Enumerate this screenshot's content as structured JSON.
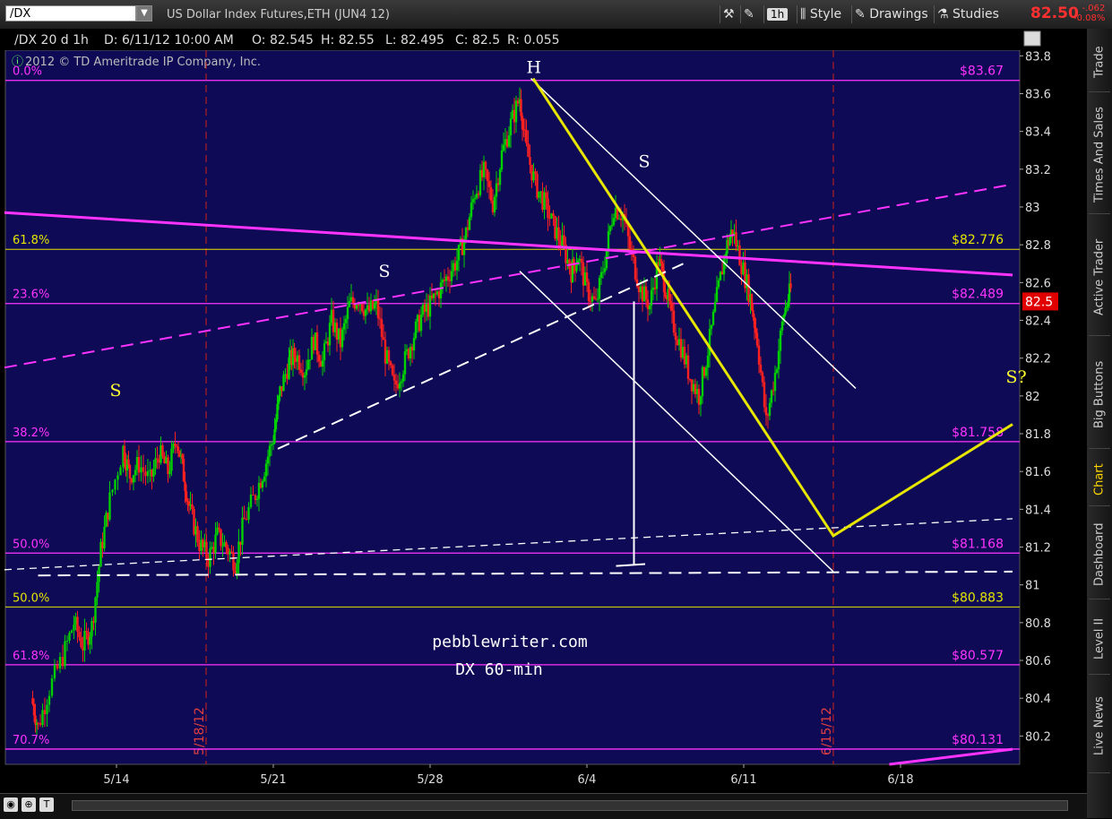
{
  "toolbar": {
    "symbol": "/DX",
    "description": "US Dollar Index Futures,ETH (JUN4 12)",
    "timeframe_btn": "1h",
    "style_btn": "Style",
    "drawings_btn": "Drawings",
    "studies_btn": "Studies",
    "last_price": "82.50",
    "net_change": "-.062",
    "pct_change": "-0.08%"
  },
  "header": {
    "symbol_period": "/DX 20 d 1h",
    "date": "D: 6/11/12 10:00 AM",
    "open": "O: 82.545",
    "high": "H: 82.55",
    "low": "L: 82.495",
    "close": "C: 82.5",
    "range": "R: 0.055",
    "copyright": "2012 © TD Ameritrade IP Company, Inc."
  },
  "side_tabs": [
    {
      "label": "Trade",
      "active": false
    },
    {
      "label": "Times And Sales",
      "active": false
    },
    {
      "label": "Active Trader",
      "active": false
    },
    {
      "label": "Big Buttons",
      "active": false
    },
    {
      "label": "Chart",
      "active": true
    },
    {
      "label": "Dashboard",
      "active": false
    },
    {
      "label": "Level II",
      "active": false
    },
    {
      "label": "Live News",
      "active": false
    }
  ],
  "bottom_bar": {
    "buttons": [
      "◉",
      "⊕",
      "T"
    ]
  },
  "colors": {
    "background": "#0e0a55",
    "up_candle": "#00d000",
    "down_candle": "#ff2020",
    "fib_magenta": "#ff33ff",
    "fib_yellow": "#e6e600",
    "annotation_yellow": "#ffff33",
    "white_lines": "#ffffff",
    "event_line": "#b02020"
  },
  "chart_data": {
    "type": "candlestick",
    "ylim": [
      80.05,
      83.83
    ],
    "y_ticks": [
      "80.2",
      "80.4",
      "80.6",
      "80.8",
      "81",
      "81.2",
      "81.4",
      "81.6",
      "81.8",
      "82",
      "82.2",
      "82.4",
      "82.6",
      "82.8",
      "83",
      "83.2",
      "83.4",
      "83.6",
      "83.8"
    ],
    "x_ticks": [
      "5/14",
      "5/21",
      "5/28",
      "6/4",
      "6/11",
      "6/18"
    ],
    "current_price_label": "82.5",
    "fib_levels": [
      {
        "pct": "0.0%",
        "price": "$83.67",
        "value": 83.67,
        "color": "magenta"
      },
      {
        "pct": "61.8%",
        "price": "$82.776",
        "value": 82.776,
        "color": "yellow"
      },
      {
        "pct": "23.6%",
        "price": "$82.489",
        "value": 82.489,
        "color": "magenta"
      },
      {
        "pct": "38.2%",
        "price": "$81.758",
        "value": 81.758,
        "color": "magenta"
      },
      {
        "pct": "50.0%",
        "price": "$81.168",
        "value": 81.168,
        "color": "magenta"
      },
      {
        "pct": "50.0%",
        "price": "$80.883",
        "value": 80.883,
        "color": "yellow"
      },
      {
        "pct": "61.8%",
        "price": "$80.577",
        "value": 80.577,
        "color": "magenta"
      },
      {
        "pct": "70.7%",
        "price": "$80.131",
        "value": 80.131,
        "color": "magenta"
      }
    ],
    "event_lines": [
      {
        "date": "5/18/12",
        "day": 4
      },
      {
        "date": "6/15/12",
        "day": 32
      }
    ],
    "pattern_labels": [
      {
        "text": "S",
        "day": -0.3,
        "value": 82.0
      },
      {
        "text": "S",
        "day": 11.7,
        "value": 82.63
      },
      {
        "text": "H",
        "day": 18.3,
        "value": 83.71
      },
      {
        "text": "S",
        "day": 23.3,
        "value": 83.21
      },
      {
        "text": "S?",
        "day": 39.7,
        "value": 82.07
      }
    ],
    "annotations": [
      "pebblewriter.com",
      "DX 60-min"
    ],
    "price_anchors": [
      [
        -3.8,
        80.4
      ],
      [
        -3.5,
        80.25
      ],
      [
        -3.0,
        80.45
      ],
      [
        -2.4,
        80.62
      ],
      [
        -1.9,
        80.8
      ],
      [
        -1.5,
        80.68
      ],
      [
        -1.1,
        80.78
      ],
      [
        -0.7,
        81.18
      ],
      [
        -0.3,
        81.45
      ],
      [
        0.3,
        81.72
      ],
      [
        0.6,
        81.58
      ],
      [
        1.0,
        81.64
      ],
      [
        1.5,
        81.55
      ],
      [
        1.9,
        81.7
      ],
      [
        2.3,
        81.6
      ],
      [
        2.7,
        81.78
      ],
      [
        3.0,
        81.58
      ],
      [
        3.3,
        81.38
      ],
      [
        3.7,
        81.22
      ],
      [
        4.1,
        81.14
      ],
      [
        4.5,
        81.26
      ],
      [
        4.9,
        81.2
      ],
      [
        5.3,
        81.12
      ],
      [
        5.7,
        81.34
      ],
      [
        6.2,
        81.48
      ],
      [
        6.6,
        81.62
      ],
      [
        7.0,
        81.78
      ],
      [
        7.3,
        82.02
      ],
      [
        7.7,
        82.18
      ],
      [
        8.0,
        82.22
      ],
      [
        8.4,
        82.14
      ],
      [
        8.8,
        82.3
      ],
      [
        9.2,
        82.18
      ],
      [
        9.6,
        82.4
      ],
      [
        10.0,
        82.28
      ],
      [
        10.4,
        82.48
      ],
      [
        10.8,
        82.52
      ],
      [
        11.2,
        82.44
      ],
      [
        11.6,
        82.48
      ],
      [
        12.0,
        82.22
      ],
      [
        12.4,
        82.04
      ],
      [
        12.8,
        82.16
      ],
      [
        13.2,
        82.3
      ],
      [
        13.6,
        82.42
      ],
      [
        14.0,
        82.48
      ],
      [
        14.4,
        82.56
      ],
      [
        14.8,
        82.64
      ],
      [
        15.2,
        82.72
      ],
      [
        15.6,
        82.86
      ],
      [
        16.0,
        83.08
      ],
      [
        16.4,
        83.18
      ],
      [
        16.8,
        83.02
      ],
      [
        17.2,
        83.28
      ],
      [
        17.6,
        83.44
      ],
      [
        18.0,
        83.58
      ],
      [
        18.3,
        83.3
      ],
      [
        18.7,
        83.12
      ],
      [
        19.1,
        83.02
      ],
      [
        19.5,
        82.9
      ],
      [
        19.9,
        82.8
      ],
      [
        20.3,
        82.66
      ],
      [
        20.6,
        82.74
      ],
      [
        21.0,
        82.56
      ],
      [
        21.4,
        82.48
      ],
      [
        21.8,
        82.72
      ],
      [
        22.2,
        83.0
      ],
      [
        22.6,
        82.96
      ],
      [
        23.0,
        82.74
      ],
      [
        23.4,
        82.56
      ],
      [
        23.8,
        82.48
      ],
      [
        24.2,
        82.72
      ],
      [
        24.5,
        82.58
      ],
      [
        24.8,
        82.4
      ],
      [
        25.2,
        82.26
      ],
      [
        25.6,
        82.1
      ],
      [
        26.0,
        82.0
      ],
      [
        26.4,
        82.24
      ],
      [
        26.8,
        82.52
      ],
      [
        27.2,
        82.78
      ],
      [
        27.5,
        82.88
      ],
      [
        27.9,
        82.7
      ],
      [
        28.3,
        82.52
      ],
      [
        28.6,
        82.3
      ],
      [
        29.0,
        81.86
      ],
      [
        29.4,
        82.12
      ],
      [
        29.8,
        82.44
      ],
      [
        30.1,
        82.56
      ]
    ],
    "lines": [
      {
        "style": "solid",
        "color": "magenta",
        "width": 3,
        "pts": [
          [
            -5,
            82.97
          ],
          [
            40,
            82.64
          ]
        ]
      },
      {
        "style": "dash",
        "color": "magenta",
        "width": 2,
        "pts": [
          [
            -5,
            82.15
          ],
          [
            40,
            83.12
          ]
        ]
      },
      {
        "style": "dash",
        "color": "white",
        "width": 2,
        "pts": [
          [
            7.2,
            81.72
          ],
          [
            25.3,
            82.7
          ]
        ]
      },
      {
        "style": "solid",
        "color": "white",
        "width": 1.5,
        "pts": [
          [
            18.5,
            83.68
          ],
          [
            33,
            82.04
          ]
        ]
      },
      {
        "style": "solid",
        "color": "white",
        "width": 1.5,
        "pts": [
          [
            18.0,
            82.66
          ],
          [
            32,
            81.07
          ]
        ]
      },
      {
        "style": "solid",
        "color": "white",
        "width": 2,
        "pts": [
          [
            23.1,
            82.5
          ],
          [
            23.1,
            81.11
          ]
        ]
      },
      {
        "style": "solid",
        "color": "white",
        "width": 2,
        "pts": [
          [
            22.3,
            81.1
          ],
          [
            23.6,
            81.11
          ]
        ]
      },
      {
        "style": "dash",
        "color": "white",
        "width": 1.3,
        "pts": [
          [
            -5,
            81.08
          ],
          [
            40,
            81.35
          ]
        ]
      },
      {
        "style": "dash",
        "color": "white",
        "width": 2,
        "pts": [
          [
            -3.5,
            81.05
          ],
          [
            40,
            81.07
          ]
        ]
      },
      {
        "style": "solid",
        "color": "yellow",
        "width": 3,
        "pts": [
          [
            18.6,
            83.68
          ],
          [
            32,
            81.26
          ],
          [
            40,
            81.85
          ]
        ]
      },
      {
        "style": "solid",
        "color": "magenta",
        "width": 3,
        "pts": [
          [
            34.5,
            80.05
          ],
          [
            40,
            80.13
          ]
        ]
      }
    ]
  }
}
